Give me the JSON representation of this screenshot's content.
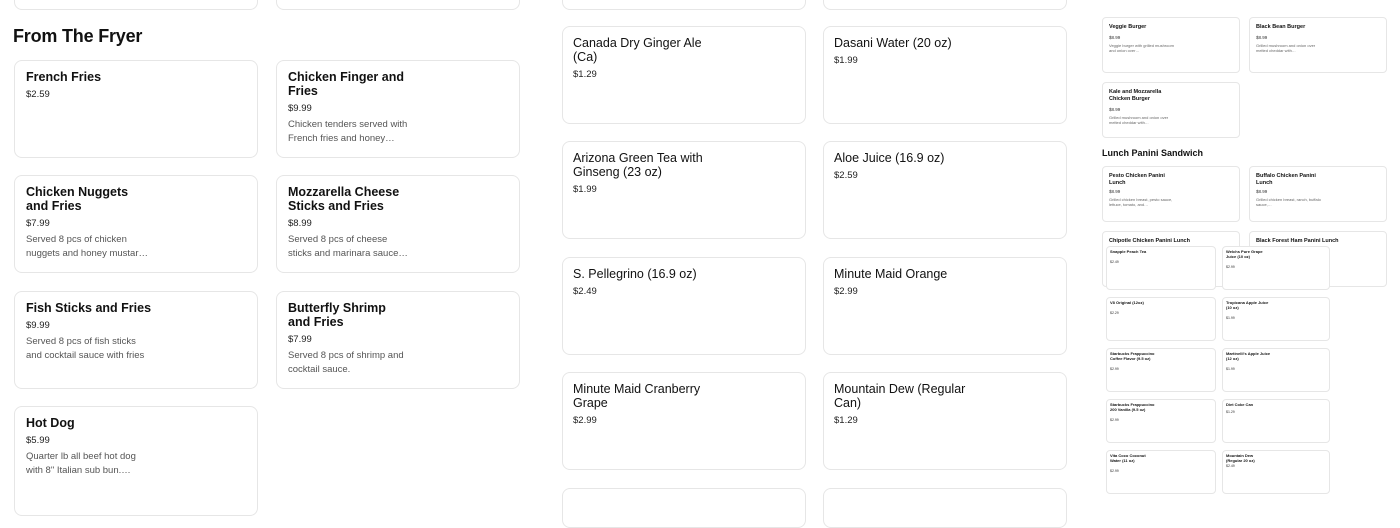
{
  "fryer": {
    "title": "From The Fryer",
    "items": [
      {
        "name": "French Fries",
        "price": "$2.59",
        "desc": ""
      },
      {
        "name": "Chicken Finger and Fries",
        "price": "$9.99",
        "desc": "Chicken tenders served with French fries and honey…"
      },
      {
        "name": "Chicken Nuggets and Fries",
        "price": "$7.99",
        "desc": "Served 8 pcs of chicken nuggets and honey mustar…"
      },
      {
        "name": "Mozzarella Cheese Sticks and Fries",
        "price": "$8.99",
        "desc": "Served 8 pcs of cheese sticks and marinara sauce…"
      },
      {
        "name": "Fish Sticks and Fries",
        "price": "$9.99",
        "desc": "Served 8 pcs of fish sticks and cocktail sauce with fries"
      },
      {
        "name": "Butterfly Shrimp and Fries",
        "price": "$7.99",
        "desc": "Served 8 pcs of shrimp and cocktail sauce."
      },
      {
        "name": "Hot Dog",
        "price": "$5.99",
        "desc": "Quarter lb all beef hot dog with 8\" Italian sub bun.…"
      }
    ]
  },
  "drinks": [
    {
      "name": "Canada Dry Ginger Ale (Ca)",
      "price": "$1.29"
    },
    {
      "name": "Dasani Water (20 oz)",
      "price": "$1.99"
    },
    {
      "name": "Arizona Green Tea with Ginseng (23 oz)",
      "price": "$1.99"
    },
    {
      "name": "Aloe Juice (16.9 oz)",
      "price": "$2.59"
    },
    {
      "name": "S. Pellegrino (16.9 oz)",
      "price": "$2.49"
    },
    {
      "name": "Minute Maid Orange",
      "price": "$2.99"
    },
    {
      "name": "Minute Maid Cranberry Grape",
      "price": "$2.99"
    },
    {
      "name": "Mountain Dew (Regular Can)",
      "price": "$1.29"
    }
  ],
  "right": {
    "burgers": [
      {
        "name": "Veggie Burger",
        "price": "$8.99",
        "desc": "Veggie burger with grilled mushroom and onion over…"
      },
      {
        "name": "Black Bean Burger",
        "price": "$8.99",
        "desc": "Grilled mushroom and onion over melted cheddar with…"
      },
      {
        "name": "Kale and Mozzarella Chicken Burger",
        "price": "$8.99",
        "desc": "Grilled mushroom and onion over melted cheddar with…"
      }
    ],
    "panini_title": "Lunch Panini Sandwich",
    "panini": [
      {
        "name": "Pesto Chicken Panini Lunch",
        "price": "$8.99",
        "desc": "Grilled chicken breast, pesto sauce, lettuce, tomato, and…"
      },
      {
        "name": "Buffalo Chicken Panini Lunch",
        "price": "$8.99",
        "desc": "Grilled chicken breast, ranch, buffalo sauce,…"
      },
      {
        "name": "Chipotle Chicken Panini Lunch",
        "price": "",
        "desc": ""
      },
      {
        "name": "Black Forest Ham Panini Lunch",
        "price": "",
        "desc": ""
      }
    ],
    "mini_drinks": [
      {
        "name": "Snapple Peach Tea",
        "price": "$2.49"
      },
      {
        "name": "Welchs Pure Grape Juice (10 oz)",
        "price": "$2.99"
      },
      {
        "name": "V8 Original (12oz)",
        "price": "$2.29"
      },
      {
        "name": "Tropicana Apple Juice (10 oz)",
        "price": "$1.99"
      },
      {
        "name": "Starbucks Frappuccino Coffee Flavor (9.5 oz)",
        "price": "$2.99"
      },
      {
        "name": "Martinelli's Apple Juice (12 oz)",
        "price": "$1.99"
      },
      {
        "name": "Starbucks Frappuccino 200 Vanilla (9.5 oz)",
        "price": "$2.99"
      },
      {
        "name": "Diet Coke Can",
        "price": "$1.29"
      },
      {
        "name": "Vita Coco Coconut Water (11 oz)",
        "price": "$2.99"
      },
      {
        "name": "Mountain Dew (Regular 20 oz)",
        "price": "$2.49"
      }
    ]
  }
}
